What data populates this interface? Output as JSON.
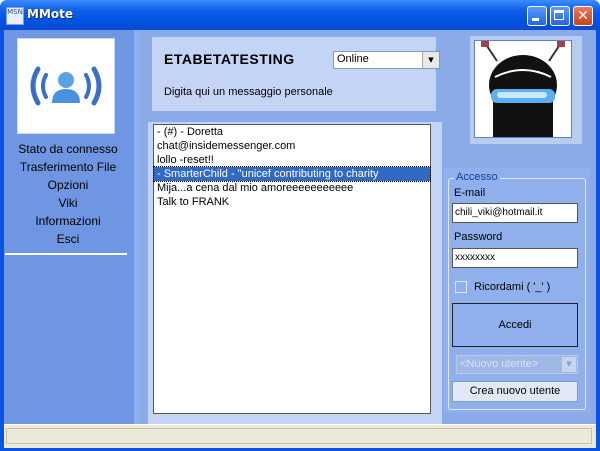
{
  "window": {
    "title": "MMote"
  },
  "sidebar": {
    "items": [
      {
        "label": "Stato da connesso"
      },
      {
        "label": "Trasferimento File"
      },
      {
        "label": "Opzioni"
      },
      {
        "label": "Viki"
      },
      {
        "label": "Informazioni"
      },
      {
        "label": "Esci"
      }
    ]
  },
  "header": {
    "username": "ETABETATESTING",
    "status_selected": "Online",
    "personal_message": "Digita qui un messaggio personale"
  },
  "contacts": [
    {
      "text": "-  (#)  -  Doretta",
      "selected": false
    },
    {
      "text": "chat@insidemessenger.com",
      "selected": false
    },
    {
      "text": "lollo -reset!!",
      "selected": false
    },
    {
      "text": "- SmarterChild - \"unicef contributing to charity",
      "selected": true
    },
    {
      "text": "Mija...a cena dal mio amoreeeeeeeeeee",
      "selected": false
    },
    {
      "text": "Talk to FRANK",
      "selected": false
    }
  ],
  "login": {
    "group_label": "Accesso",
    "email_label": "E-mail",
    "email_value": "chili_viki@hotmail.it",
    "password_label": "Password",
    "password_value": "xxxxxxxx",
    "remember_label": "Ricordami  ( '_' )",
    "remember_checked": false,
    "login_button": "Accedi",
    "user_select_placeholder": "<Nuovo utente>",
    "create_user_button": "Crea nuovo utente"
  },
  "colors": {
    "titlebar": "#0054e3",
    "sidebar": "#6f96e2",
    "panel": "#c4d4f4",
    "selection": "#316ac5",
    "statusbar": "#ece9d8"
  }
}
